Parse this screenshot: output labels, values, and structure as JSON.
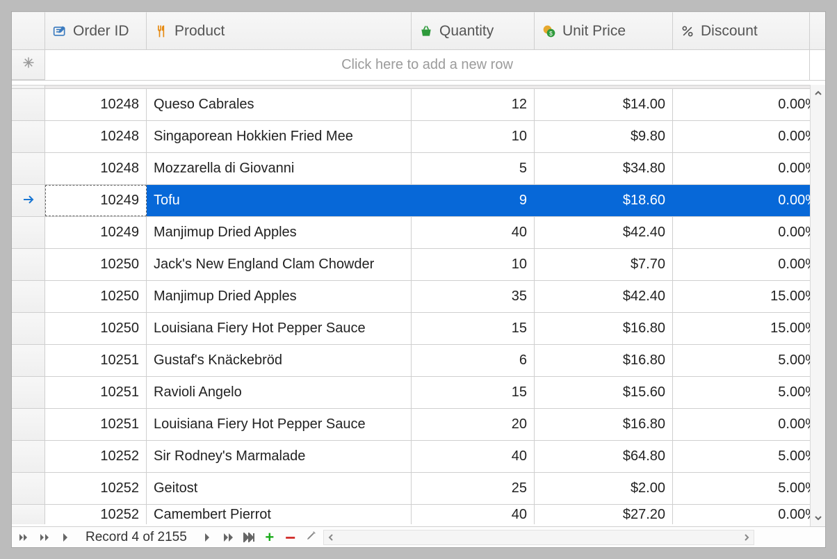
{
  "columns": {
    "order_id": "Order ID",
    "product": "Product",
    "quantity": "Quantity",
    "unit_price": "Unit Price",
    "discount": "Discount"
  },
  "new_row_placeholder": "Click here to add a new row",
  "rows": [
    {
      "order_id": "10248",
      "product": "Queso Cabrales",
      "qty": "12",
      "price": "$14.00",
      "disc": "0.00%",
      "selected": false
    },
    {
      "order_id": "10248",
      "product": "Singaporean Hokkien Fried Mee",
      "qty": "10",
      "price": "$9.80",
      "disc": "0.00%",
      "selected": false
    },
    {
      "order_id": "10248",
      "product": "Mozzarella di Giovanni",
      "qty": "5",
      "price": "$34.80",
      "disc": "0.00%",
      "selected": false
    },
    {
      "order_id": "10249",
      "product": "Tofu",
      "qty": "9",
      "price": "$18.60",
      "disc": "0.00%",
      "selected": true
    },
    {
      "order_id": "10249",
      "product": "Manjimup Dried Apples",
      "qty": "40",
      "price": "$42.40",
      "disc": "0.00%",
      "selected": false
    },
    {
      "order_id": "10250",
      "product": "Jack's New England Clam Chowder",
      "qty": "10",
      "price": "$7.70",
      "disc": "0.00%",
      "selected": false
    },
    {
      "order_id": "10250",
      "product": "Manjimup Dried Apples",
      "qty": "35",
      "price": "$42.40",
      "disc": "15.00%",
      "selected": false
    },
    {
      "order_id": "10250",
      "product": "Louisiana Fiery Hot Pepper Sauce",
      "qty": "15",
      "price": "$16.80",
      "disc": "15.00%",
      "selected": false
    },
    {
      "order_id": "10251",
      "product": "Gustaf's Knäckebröd",
      "qty": "6",
      "price": "$16.80",
      "disc": "5.00%",
      "selected": false
    },
    {
      "order_id": "10251",
      "product": "Ravioli Angelo",
      "qty": "15",
      "price": "$15.60",
      "disc": "5.00%",
      "selected": false
    },
    {
      "order_id": "10251",
      "product": "Louisiana Fiery Hot Pepper Sauce",
      "qty": "20",
      "price": "$16.80",
      "disc": "0.00%",
      "selected": false
    },
    {
      "order_id": "10252",
      "product": "Sir Rodney's Marmalade",
      "qty": "40",
      "price": "$64.80",
      "disc": "5.00%",
      "selected": false
    },
    {
      "order_id": "10252",
      "product": "Geitost",
      "qty": "25",
      "price": "$2.00",
      "disc": "5.00%",
      "selected": false
    },
    {
      "order_id": "10252",
      "product": "Camembert Pierrot",
      "qty": "40",
      "price": "$27.20",
      "disc": "0.00%",
      "selected": false
    }
  ],
  "navigator": {
    "record_text": "Record 4 of 2155"
  }
}
